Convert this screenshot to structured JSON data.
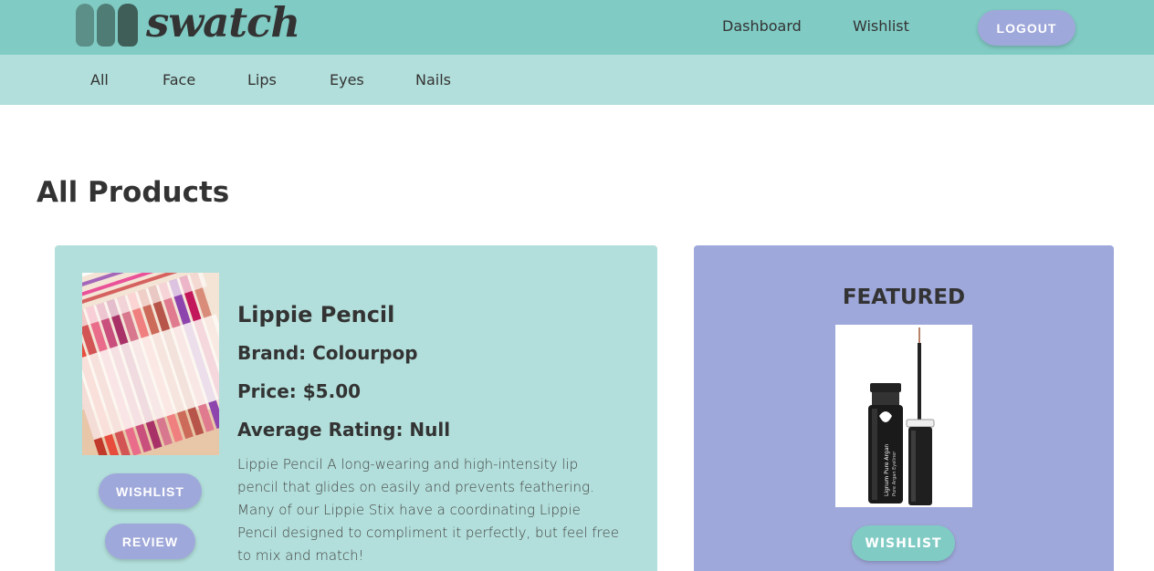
{
  "header": {
    "logo_text": "swatch",
    "nav": {
      "dashboard": "Dashboard",
      "wishlist": "Wishlist"
    },
    "logout_label": "LOGOUT"
  },
  "categories": [
    "All",
    "Face",
    "Lips",
    "Eyes",
    "Nails"
  ],
  "page_title": "All Products",
  "product": {
    "name": "Lippie Pencil",
    "brand": "Brand: Colourpop",
    "price": "Price: $5.00",
    "rating": "Average Rating: Null",
    "description": "Lippie Pencil A long-wearing and high-intensity lip pencil that glides on easily and prevents feathering. Many of our Lippie Stix have a coordinating Lippie Pencil designed to compliment it perfectly, but feel free to mix and match!",
    "wishlist_label": "WISHLIST",
    "review_label": "REVIEW",
    "image_icon": "lip-pencils-image"
  },
  "featured": {
    "title": "FEATURED",
    "wishlist_label": "WISHLIST",
    "image_icon": "eyeliner-image"
  },
  "colors": {
    "header_bg": "#80cbc4",
    "category_bg": "#b2dfdb",
    "product_card_bg": "#b2dfdb",
    "featured_card_bg": "#9fa8da",
    "button_purple": "#9fa8da",
    "button_teal": "#80cbc4",
    "text": "#333333"
  }
}
